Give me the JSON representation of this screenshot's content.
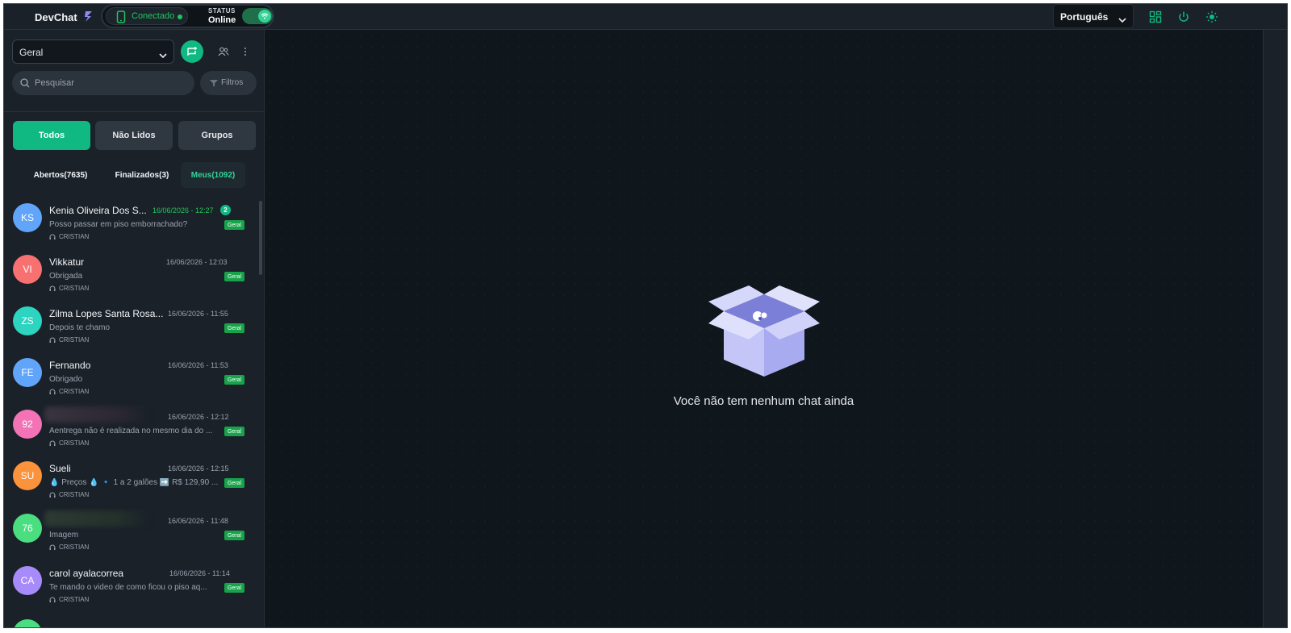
{
  "header": {
    "brand": "DevChat",
    "connection": "Conectado",
    "status_label": "STATUS",
    "status_value": "Online",
    "language": "Português",
    "icons": [
      "lightning-icon",
      "phone-icon",
      "wifi-icon",
      "grid-icon",
      "power-icon",
      "sun-icon"
    ],
    "accent_color": "#10b981"
  },
  "sidebar": {
    "queue_select": "Geral",
    "search_placeholder": "Pesquisar",
    "filter_label": "Filtros",
    "tabs": [
      {
        "label": "Todos",
        "active": true
      },
      {
        "label": "Não Lidos",
        "active": false
      },
      {
        "label": "Grupos",
        "active": false
      }
    ],
    "subtabs": [
      {
        "label": "Abertos(7635)",
        "active": false
      },
      {
        "label": "Finalizados(3)",
        "active": false
      },
      {
        "label": "Meus(1092)",
        "active": true
      }
    ],
    "chats": [
      {
        "initials": "KS",
        "name": "Kenia Oliveira Dos S...",
        "time": "16/06/2026 - 12:27",
        "unread": "2",
        "preview": "Posso passar em piso emborrachado?",
        "tag": "Geral",
        "agent": "CRISTIAN",
        "color": "#60a5fa"
      },
      {
        "initials": "VI",
        "name": "Vikkatur",
        "time": "16/06/2026 - 12:03",
        "preview": "Obrigada",
        "tag": "Geral",
        "agent": "CRISTIAN",
        "color": "#f87171"
      },
      {
        "initials": "ZS",
        "name": "Zilma Lopes Santa Rosa...",
        "time": "16/06/2026 - 11:55",
        "preview": "Depois te chamo",
        "tag": "Geral",
        "agent": "CRISTIAN",
        "color": "#2dd4bf"
      },
      {
        "initials": "FE",
        "name": "Fernando",
        "time": "16/06/2026 - 11:53",
        "preview": "Obrigado",
        "tag": "Geral",
        "agent": "CRISTIAN",
        "color": "#60a5fa"
      },
      {
        "initials": "92",
        "name": "",
        "time": "16/06/2026 - 12:12",
        "preview": "Aentrega não é realizada no mesmo dia do ...",
        "tag": "Geral",
        "agent": "CRISTIAN",
        "color": "#f472b6"
      },
      {
        "initials": "SU",
        "name": "Sueli",
        "time": "16/06/2026 - 12:15",
        "preview": "💧 Preços 💧 🔹 1 a 2 galões ➡️ R$ 129,90 ...",
        "tag": "Geral",
        "agent": "CRISTIAN",
        "color": "#fb923c"
      },
      {
        "initials": "76",
        "name": "",
        "time": "16/06/2026 - 11:48",
        "preview": "Imagem",
        "tag": "Geral",
        "agent": "CRISTIAN",
        "color": "#4ade80"
      },
      {
        "initials": "CA",
        "name": "carol ayalacorrea",
        "time": "16/06/2026 - 11:14",
        "preview": "Te mando o video de como ficou o piso aq...",
        "tag": "Geral",
        "agent": "CRISTIAN",
        "color": "#a78bfa"
      }
    ]
  },
  "main": {
    "empty_message": "Você não tem nenhum chat ainda"
  }
}
